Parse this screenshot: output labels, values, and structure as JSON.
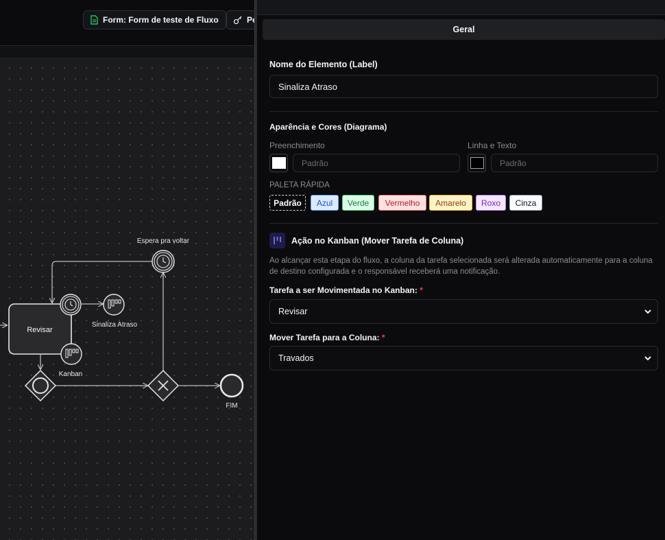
{
  "toolbar": {
    "form_button": "Form: Form de teste de Fluxo",
    "second_button": "Pe"
  },
  "diagram": {
    "labels": {
      "espera": "Espera pra voltar",
      "revisar": "Revisar",
      "sinaliza": "Sinaliza Atraso",
      "kanban": "Kanban",
      "fim": "FIM"
    }
  },
  "panel": {
    "tab": "Geral",
    "element_name_label": "Nome do Elemento (Label)",
    "element_name_value": "Sinaliza Atraso",
    "appearance_title": "Aparência e Cores (Diagrama)",
    "fill_label": "Preenchimento",
    "fill_placeholder": "Padrão",
    "fill_color": "#ffffff",
    "line_label": "Linha e Texto",
    "line_placeholder": "Padrão",
    "line_color": "#000000",
    "palette_title": "PALETA RÁPIDA",
    "palette": [
      {
        "label": "Padrão",
        "bg": "#0b0b0d",
        "fg": "#ffffff",
        "border": "#d1d5db"
      },
      {
        "label": "Azul",
        "bg": "#dbeafe",
        "fg": "#1d4ed8",
        "border": "#60a5fa"
      },
      {
        "label": "Verde",
        "bg": "#dcfce7",
        "fg": "#15803d",
        "border": "#4ade80"
      },
      {
        "label": "Vermelho",
        "bg": "#fee2e2",
        "fg": "#b91c1c",
        "border": "#f87171"
      },
      {
        "label": "Amarelo",
        "bg": "#fef3c7",
        "fg": "#92400e",
        "border": "#fbbf24"
      },
      {
        "label": "Roxo",
        "bg": "#f3e8ff",
        "fg": "#7e22ce",
        "border": "#c084fc"
      },
      {
        "label": "Cinza",
        "bg": "#f9fafb",
        "fg": "#111827",
        "border": "#9ca3af"
      }
    ],
    "kanban_title": "Ação no Kanban (Mover Tarefa de Coluna)",
    "kanban_desc": "Ao alcançar esta etapa do fluxo, a coluna da tarefa selecionada será alterada automaticamente para a coluna de destino configurada e o responsável receberá uma notificação.",
    "task_label": "Tarefa a ser Movimentada no Kanban:",
    "task_value": "Revisar",
    "column_label": "Mover Tarefa para a Coluna:",
    "column_value": "Travados",
    "required_mark": "*"
  }
}
